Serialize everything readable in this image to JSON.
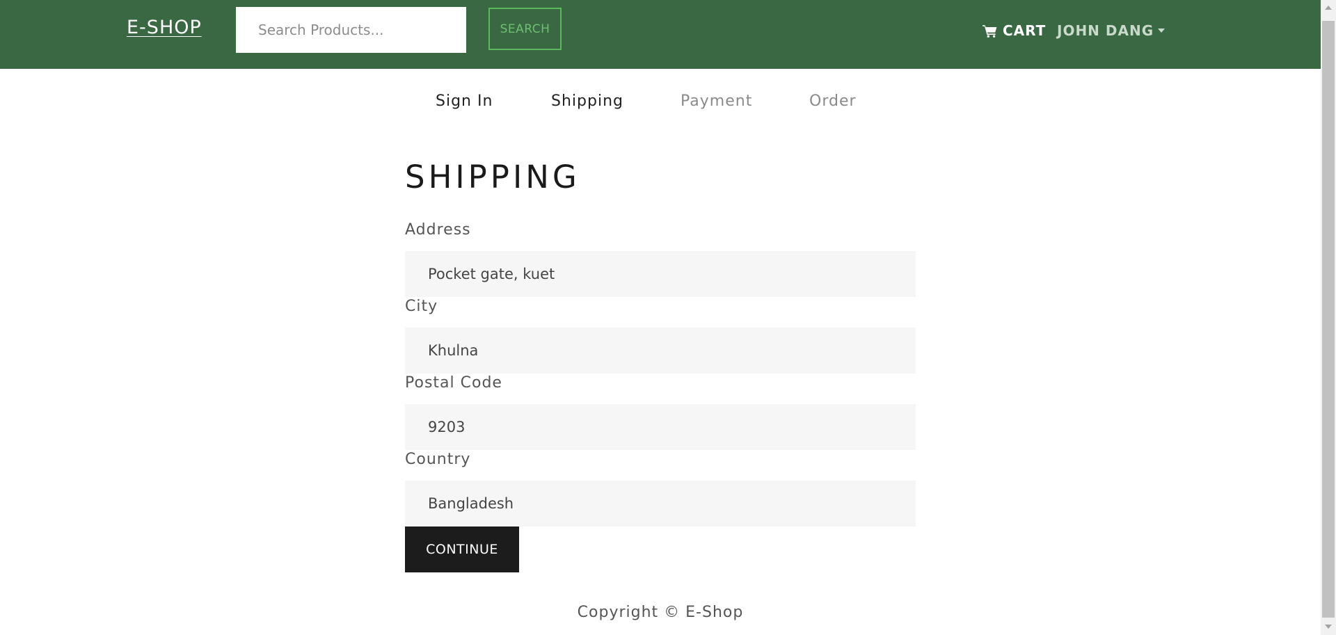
{
  "colors": {
    "navbar_bg": "#3a6843",
    "search_button_accent": "#5cb85c",
    "continue_button_bg": "#1c1c1c",
    "field_bg": "#f6f6f7"
  },
  "navbar": {
    "brand": "E-SHOP",
    "search": {
      "placeholder": "Search Products...",
      "value": ""
    },
    "search_button": "SEARCH",
    "cart": {
      "icon": "shopping-cart-icon",
      "label": "CART"
    },
    "user": {
      "name": "JOHN DANG",
      "icon": "caret-down-icon"
    }
  },
  "checkout_steps": [
    {
      "label": "Sign In",
      "state": "active"
    },
    {
      "label": "Shipping",
      "state": "active"
    },
    {
      "label": "Payment",
      "state": "disabled"
    },
    {
      "label": "Order",
      "state": "disabled"
    }
  ],
  "form": {
    "title": "SHIPPING",
    "fields": [
      {
        "label": "Address",
        "value": "Pocket gate, kuet"
      },
      {
        "label": "City",
        "value": "Khulna"
      },
      {
        "label": "Postal Code",
        "value": "9203"
      },
      {
        "label": "Country",
        "value": "Bangladesh"
      }
    ],
    "submit": "CONTINUE"
  },
  "footer": {
    "copyright": "Copyright © E-Shop"
  }
}
